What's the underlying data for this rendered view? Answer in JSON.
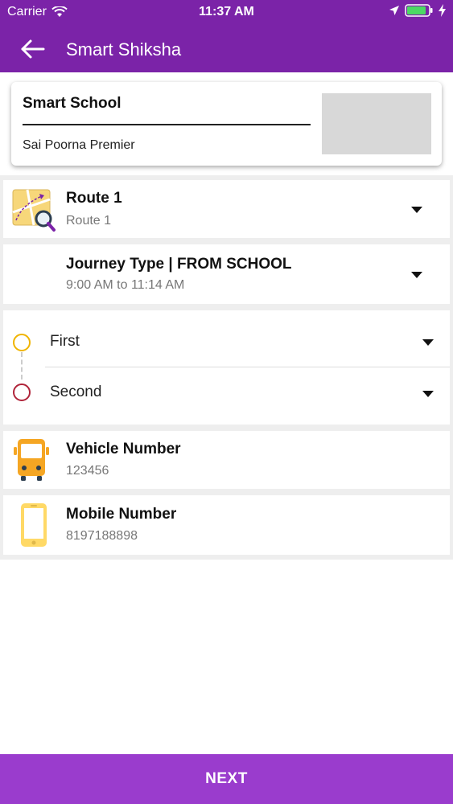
{
  "status_bar": {
    "carrier": "Carrier",
    "time": "11:37 AM"
  },
  "nav": {
    "title": "Smart Shiksha",
    "back_icon": "arrow-left-icon"
  },
  "school": {
    "name": "Smart School",
    "branch": "Sai Poorna Premier"
  },
  "route": {
    "title": "Route 1",
    "subtitle": "Route 1",
    "icon": "map-search-icon"
  },
  "journey": {
    "title": "Journey Type | FROM SCHOOL",
    "subtitle": "9:00 AM to 11:14 AM"
  },
  "stops": [
    {
      "label": "First",
      "color": "#f0b400"
    },
    {
      "label": "Second",
      "color": "#b0243a"
    }
  ],
  "vehicle": {
    "title": "Vehicle Number",
    "value": "123456",
    "icon": "bus-icon"
  },
  "mobile": {
    "title": "Mobile Number",
    "value": "8197188898",
    "icon": "phone-icon"
  },
  "footer": {
    "next_label": "NEXT"
  },
  "colors": {
    "brand": "#7b23a8",
    "footer": "#9a3ccd",
    "accent_yellow": "#f5a623"
  }
}
